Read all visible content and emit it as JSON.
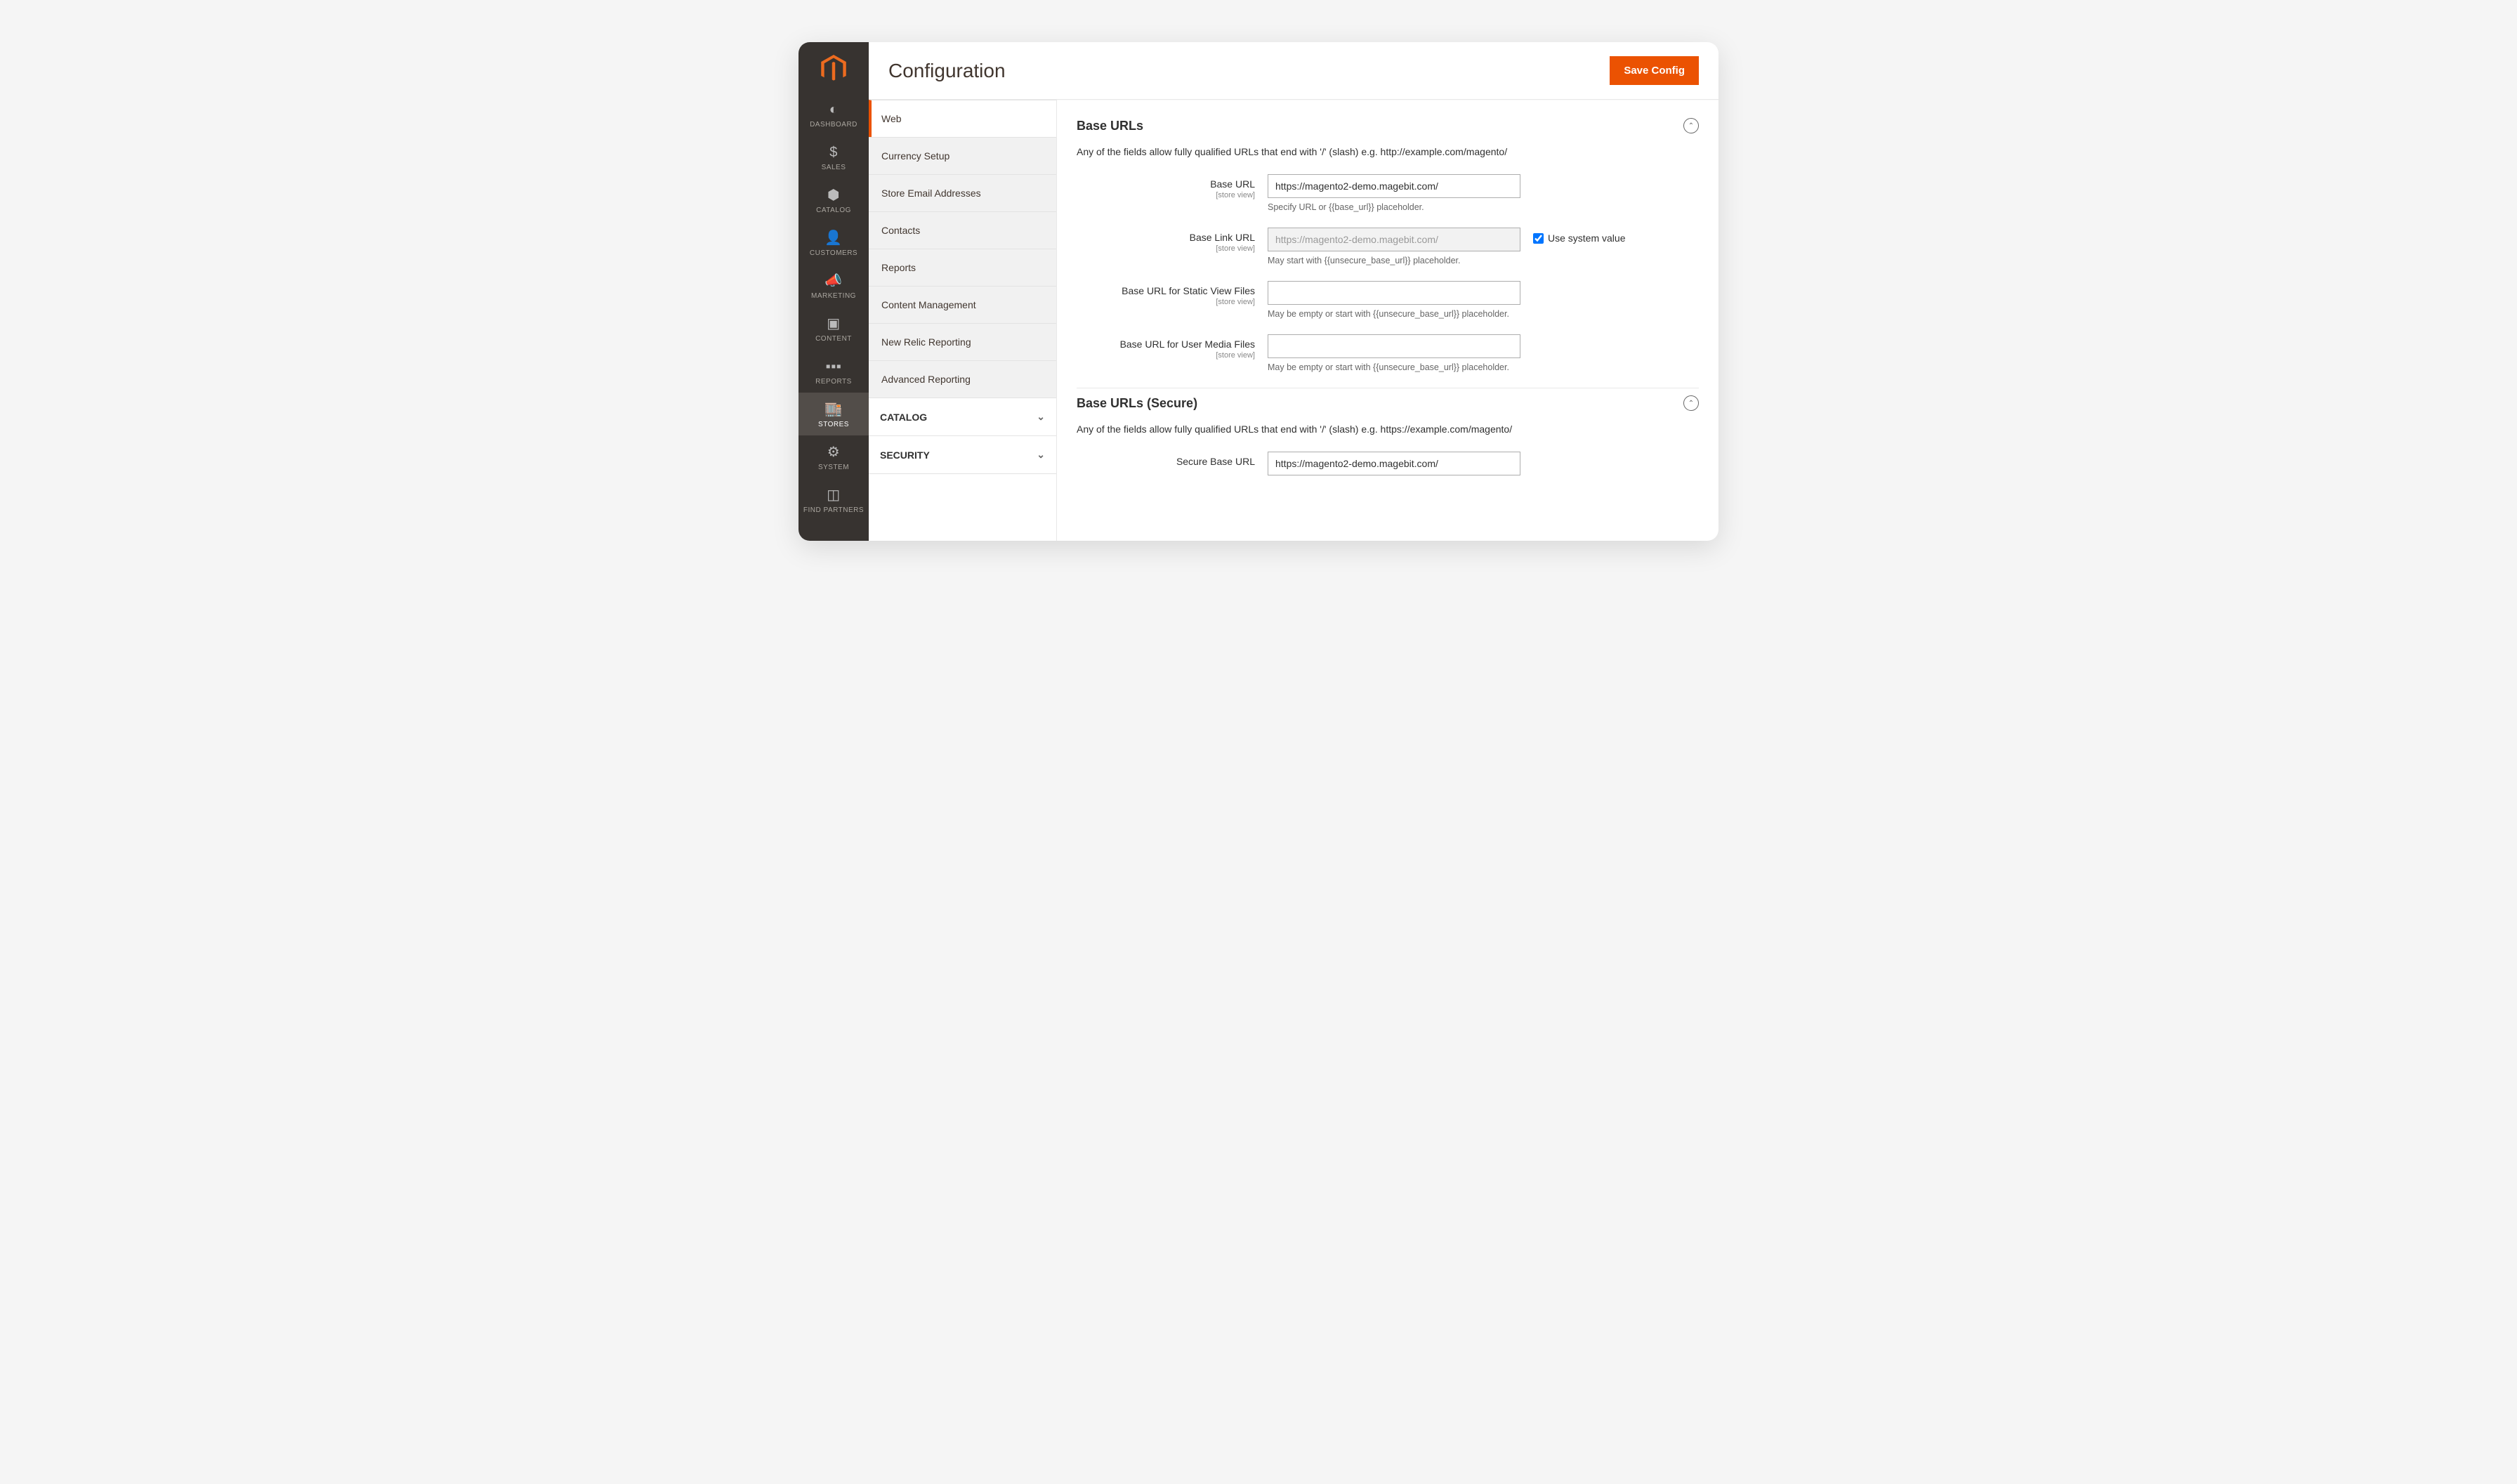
{
  "header": {
    "title": "Configuration",
    "save_label": "Save Config"
  },
  "adminnav": {
    "items": [
      {
        "label": "DASHBOARD",
        "icon": "gauge"
      },
      {
        "label": "SALES",
        "icon": "dollar"
      },
      {
        "label": "CATALOG",
        "icon": "cube"
      },
      {
        "label": "CUSTOMERS",
        "icon": "person"
      },
      {
        "label": "MARKETING",
        "icon": "megaphone"
      },
      {
        "label": "CONTENT",
        "icon": "layout"
      },
      {
        "label": "REPORTS",
        "icon": "bars"
      },
      {
        "label": "STORES",
        "icon": "storefront"
      },
      {
        "label": "SYSTEM",
        "icon": "gear"
      },
      {
        "label": "FIND PARTNERS",
        "icon": "blocks"
      }
    ],
    "active_index": 7
  },
  "config_sidebar": {
    "general_items": [
      {
        "label": "Web"
      },
      {
        "label": "Currency Setup"
      },
      {
        "label": "Store Email Addresses"
      },
      {
        "label": "Contacts"
      },
      {
        "label": "Reports"
      },
      {
        "label": "Content Management"
      },
      {
        "label": "New Relic Reporting"
      },
      {
        "label": "Advanced Reporting"
      }
    ],
    "general_active_index": 0,
    "sections": [
      {
        "label": "CATALOG"
      },
      {
        "label": "SECURITY"
      }
    ]
  },
  "base_urls": {
    "title": "Base URLs",
    "helper": "Any of the fields allow fully qualified URLs that end with '/' (slash) e.g. http://example.com/magento/",
    "scope": "[store view]",
    "fields": {
      "base_url": {
        "label": "Base URL",
        "value": "https://magento2-demo.magebit.com/",
        "note": "Specify URL or {{base_url}} placeholder."
      },
      "base_link_url": {
        "label": "Base Link URL",
        "value": "https://magento2-demo.magebit.com/",
        "note": "May start with {{unsecure_base_url}} placeholder."
      },
      "static": {
        "label": "Base URL for Static View Files",
        "value": "",
        "note": "May be empty or start with {{unsecure_base_url}} placeholder."
      },
      "media": {
        "label": "Base URL for User Media Files",
        "value": "",
        "note": "May be empty or start with {{unsecure_base_url}} placeholder."
      }
    },
    "use_system_value_label": "Use system value"
  },
  "base_urls_secure": {
    "title": "Base URLs (Secure)",
    "helper": "Any of the fields allow fully qualified URLs that end with '/' (slash) e.g. https://example.com/magento/",
    "secure_base_url_label": "Secure Base URL",
    "secure_base_url_value": "https://magento2-demo.magebit.com/"
  }
}
